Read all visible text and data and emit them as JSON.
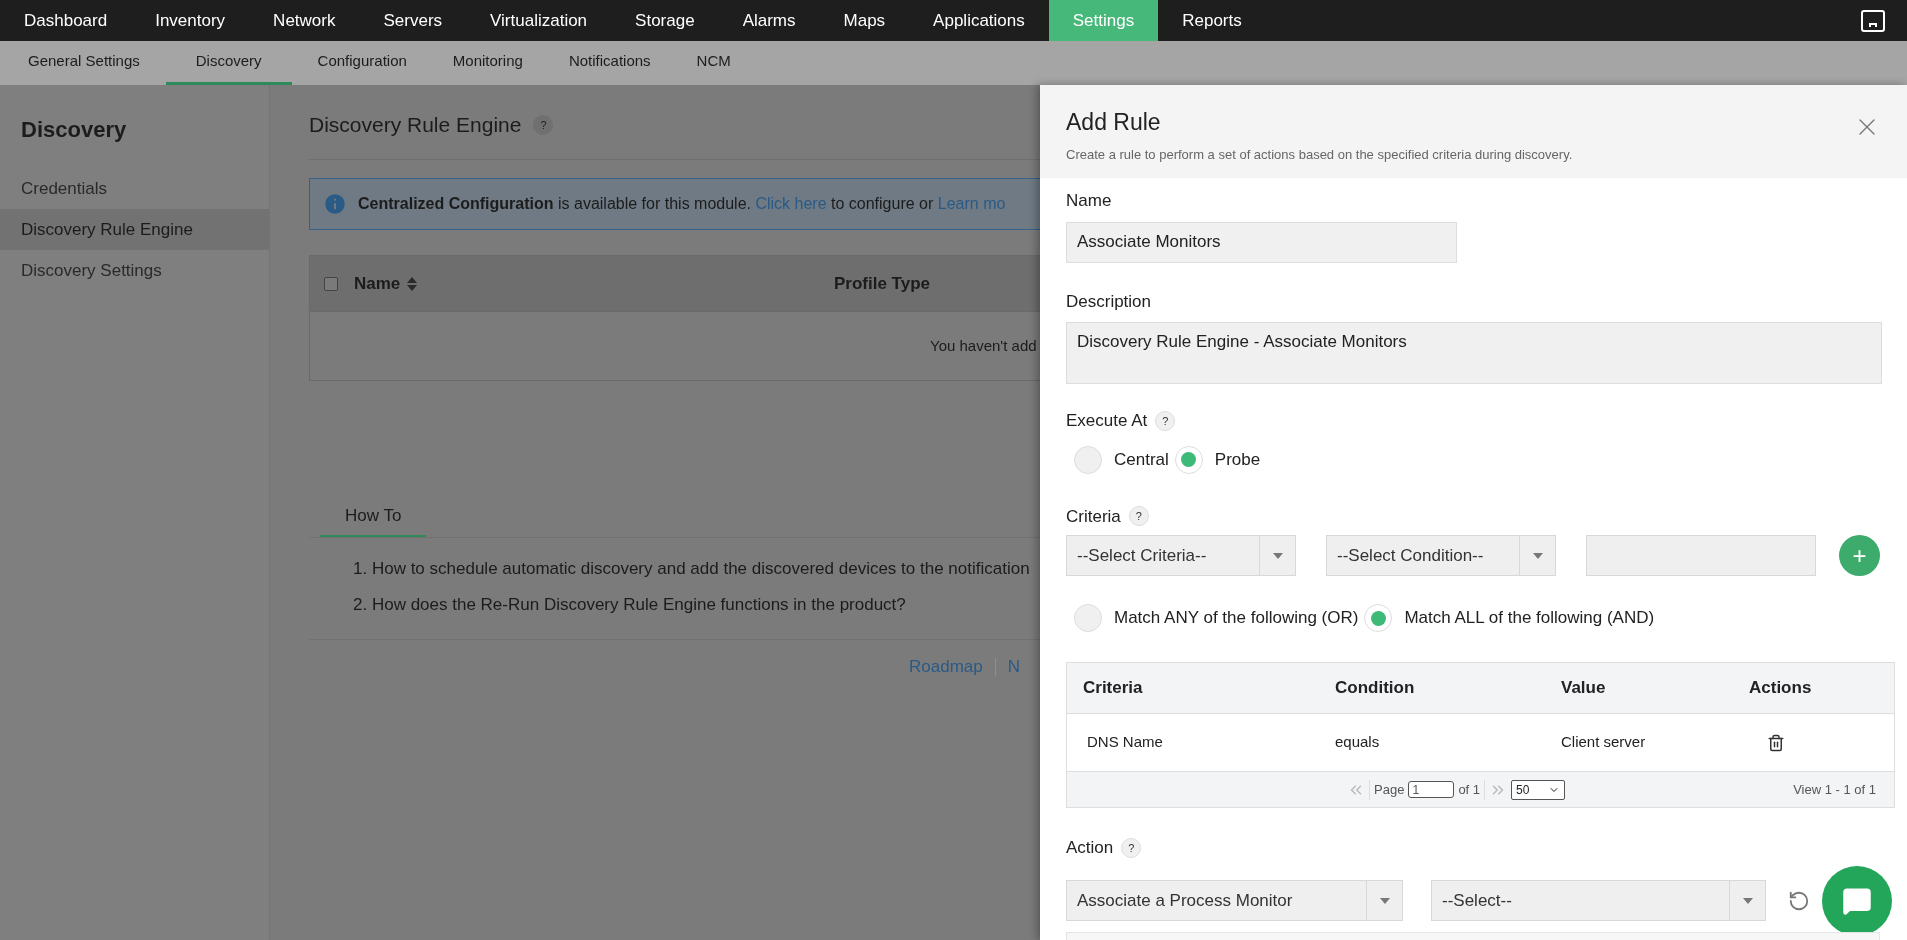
{
  "top_nav": [
    {
      "label": "Dashboard",
      "selected": false
    },
    {
      "label": "Inventory",
      "selected": false
    },
    {
      "label": "Network",
      "selected": false
    },
    {
      "label": "Servers",
      "selected": false
    },
    {
      "label": "Virtualization",
      "selected": false
    },
    {
      "label": "Storage",
      "selected": false
    },
    {
      "label": "Alarms",
      "selected": false
    },
    {
      "label": "Maps",
      "selected": false
    },
    {
      "label": "Applications",
      "selected": false
    },
    {
      "label": "Settings",
      "selected": true
    },
    {
      "label": "Reports",
      "selected": false
    }
  ],
  "sub_nav": [
    {
      "label": "General Settings",
      "selected": false
    },
    {
      "label": "Discovery",
      "selected": true
    },
    {
      "label": "Configuration",
      "selected": false
    },
    {
      "label": "Monitoring",
      "selected": false
    },
    {
      "label": "Notifications",
      "selected": false
    },
    {
      "label": "NCM",
      "selected": false
    }
  ],
  "sidebar": {
    "title": "Discovery",
    "items": [
      {
        "label": "Credentials",
        "selected": false
      },
      {
        "label": "Discovery Rule Engine",
        "selected": true
      },
      {
        "label": "Discovery Settings",
        "selected": false
      }
    ]
  },
  "main": {
    "title": "Discovery Rule Engine",
    "help": "?",
    "banner": [
      {
        "kind": "text",
        "text": "**Centralized Configuration** is available for this module."
      },
      {
        "kind": "link",
        "text": "Click here"
      },
      {
        "kind": "text",
        "text": "to configure or"
      },
      {
        "kind": "link",
        "text": "Learn mo"
      }
    ],
    "table": {
      "select_all": {
        "checked": false
      },
      "columns": [
        {
          "label": "Name",
          "sortable": true
        },
        {
          "label": "Profile Type",
          "sortable": false
        }
      ],
      "empty_message": "You haven't add"
    },
    "how_to": {
      "tab": "How To",
      "items": [
        "1. How to schedule automatic discovery and add the discovered devices to the notification",
        "2. How does the Re-Run Discovery Rule Engine functions in the product?"
      ]
    },
    "footer_links": [
      "Roadmap",
      "N"
    ]
  },
  "drawer": {
    "title": "Add Rule",
    "subtitle": "Create a rule to perform a set of actions based on the specified criteria during discovery.",
    "name": {
      "label": "Name",
      "value": "Associate Monitors"
    },
    "description": {
      "label": "Description",
      "value": "Discovery Rule Engine - Associate Monitors"
    },
    "execute_at": {
      "label": "Execute At",
      "help": "?",
      "options": [
        {
          "label": "Central",
          "selected": false
        },
        {
          "label": "Probe",
          "selected": true
        }
      ]
    },
    "criteria": {
      "label": "Criteria",
      "help": "?",
      "criteria_select": "--Select Criteria--",
      "condition_select": "--Select Condition--",
      "add": "+",
      "match": [
        {
          "label": "Match ANY of the following (OR)",
          "selected": false
        },
        {
          "label": "Match ALL of the following (AND)",
          "selected": true
        }
      ],
      "table": {
        "columns": [
          "Criteria",
          "Condition",
          "Value",
          "Actions"
        ],
        "rows": [
          {
            "criteria": "DNS Name",
            "condition": "equals",
            "value": "Client server"
          }
        ],
        "pager": {
          "page_label": "Page",
          "page": "1",
          "of": "of 1",
          "page_size": "50",
          "view": "View 1 - 1 of 1"
        }
      }
    },
    "action": {
      "label": "Action",
      "help": "?",
      "action_select": "Associate a Process Monitor",
      "target_select": "--Select--"
    }
  }
}
